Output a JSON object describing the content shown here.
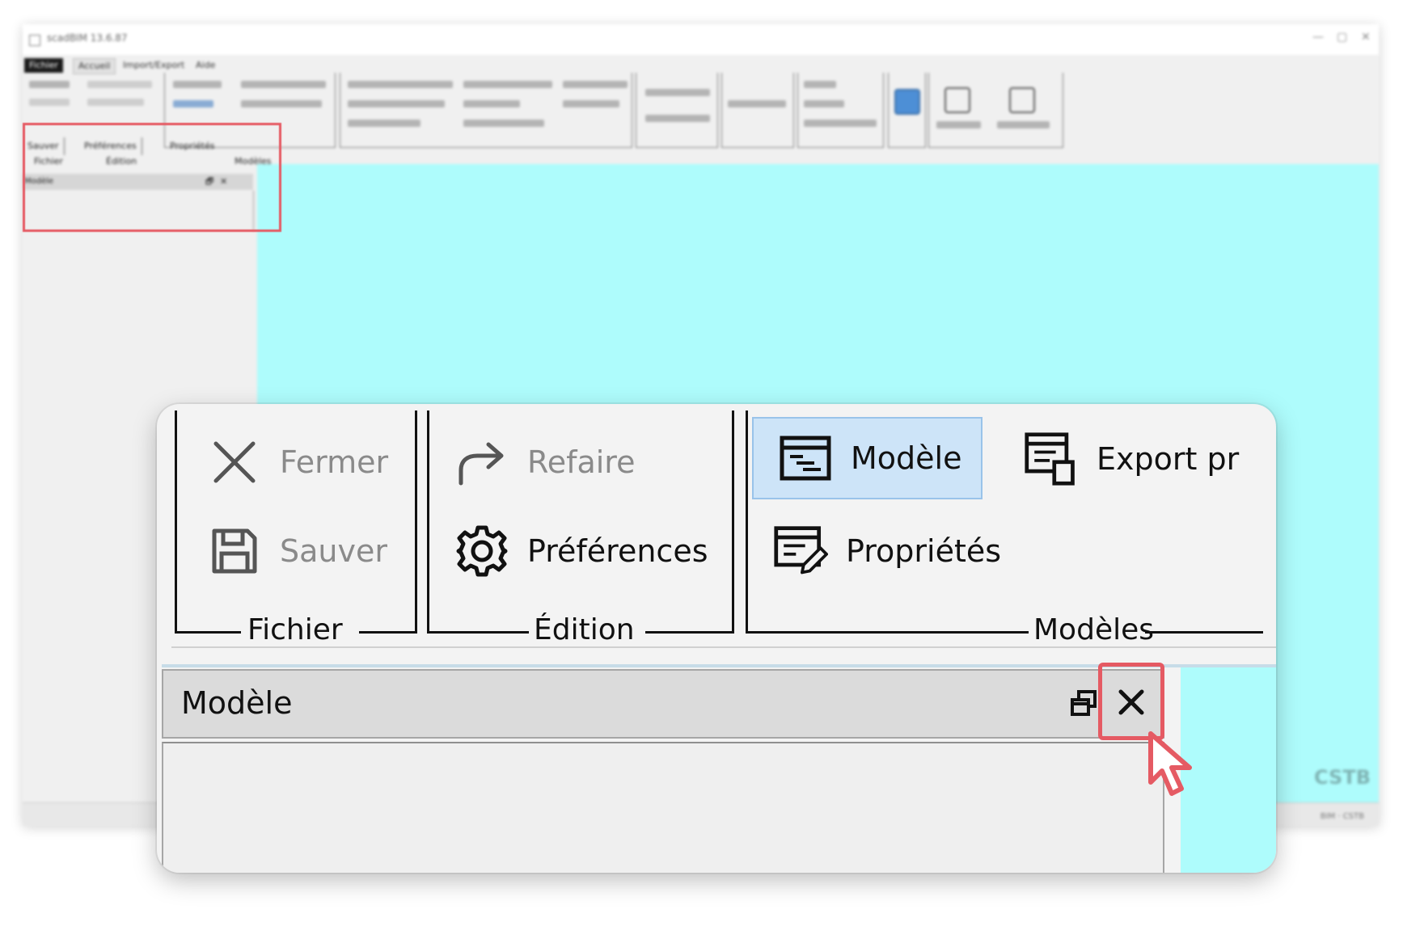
{
  "window": {
    "title": "scadBIM 13.6.87",
    "controls": [
      "—",
      "▢",
      "✕"
    ]
  },
  "menubar": {
    "items": [
      "Fichier",
      "Accueil",
      "Import/Export",
      "Aide"
    ]
  },
  "background_small_ribbon": {
    "buttons": [
      "Sauver",
      "Préférences",
      "Propriétés"
    ],
    "group_labels": [
      "Fichier",
      "Édition",
      "Modèles"
    ],
    "panel_title": "Modèle",
    "panel_close": "✕",
    "panel_restore": "🗗"
  },
  "background_footer": {
    "logo": "CSTB",
    "text": "BIM · CSTB"
  },
  "zoom": {
    "groups": [
      {
        "label": "Fichier"
      },
      {
        "label": "Édition"
      },
      {
        "label": "Modèles"
      }
    ],
    "buttons": {
      "fermer": "Fermer",
      "sauver": "Sauver",
      "refaire": "Refaire",
      "preferences": "Préférences",
      "modele": "Modèle",
      "export": "Export pr",
      "proprietes": "Propriétés"
    },
    "dock": {
      "title": "Modèle"
    }
  },
  "icons": {
    "close": "close-icon",
    "save": "save-icon",
    "redo": "redo-icon",
    "gear": "gear-icon",
    "model": "model-icon",
    "export": "export-icon",
    "properties": "properties-icon",
    "restore": "restore-icon",
    "cursor": "cursor-icon"
  },
  "colors": {
    "viewport": "#aefcfc",
    "highlight": "#e55a63",
    "selected_button": "#cde4f8",
    "disabled_text": "#8a8a8a"
  }
}
